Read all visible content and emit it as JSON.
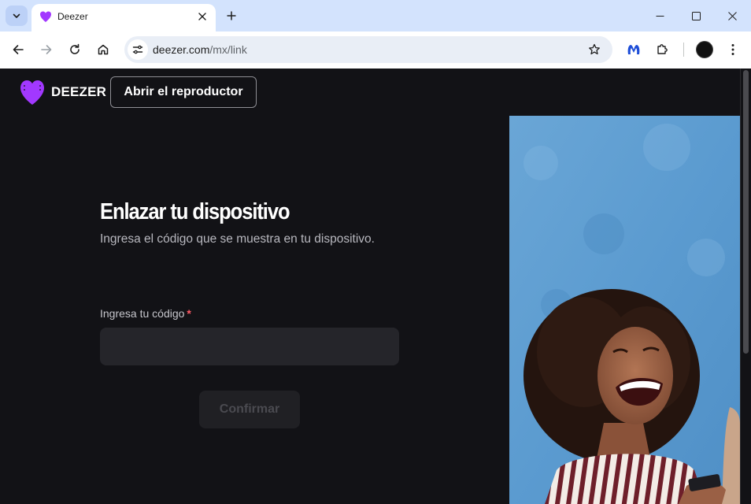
{
  "browser": {
    "tab": {
      "title": "Deezer"
    },
    "url": {
      "domain": "deezer.com",
      "path": "/mx/link"
    }
  },
  "header": {
    "logo_text": "DEEZER",
    "open_player_label": "Abrir el reproductor"
  },
  "main": {
    "title": "Enlazar tu dispositivo",
    "subtitle": "Ingresa el código que se muestra en tu dispositivo.",
    "code_field": {
      "label": "Ingresa tu código",
      "required_mark": "*",
      "value": "",
      "placeholder": ""
    },
    "confirm_label": "Confirmar",
    "confirm_disabled": true
  },
  "colors": {
    "brand_purple": "#a238ff",
    "page_bg": "#121216",
    "input_bg": "#25252a",
    "required": "#ff5a66"
  },
  "icons": [
    "tab-search-icon",
    "deezer-favicon",
    "close-icon",
    "plus-icon",
    "minimize-icon",
    "maximize-icon",
    "window-close-icon",
    "back-icon",
    "forward-icon",
    "reload-icon",
    "home-icon",
    "site-info-icon",
    "star-icon",
    "malwarebytes-icon",
    "extensions-icon",
    "profile-avatar",
    "kebab-menu-icon",
    "deezer-logo-icon"
  ]
}
